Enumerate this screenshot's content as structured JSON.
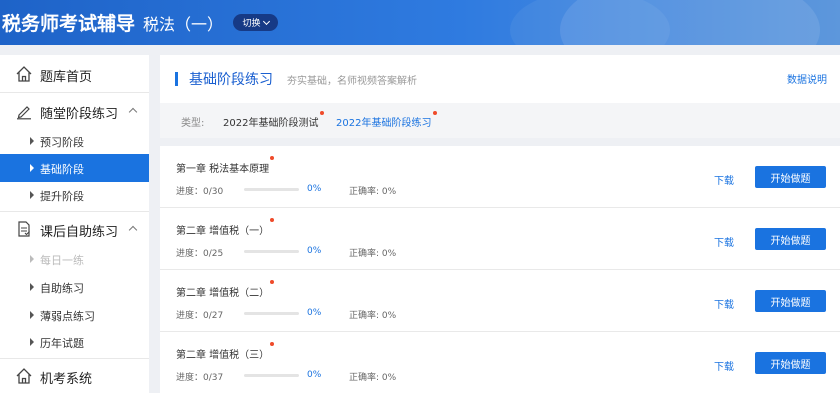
{
  "header": {
    "app_title": "税务师考试辅导",
    "subject": "税法（一）",
    "switch_label": "切换"
  },
  "sidebar": {
    "groups": [
      {
        "label": "题库首页",
        "icon": "home-icon"
      },
      {
        "label": "随堂阶段练习",
        "icon": "pen-icon"
      },
      {
        "label": "课后自助练习",
        "icon": "document-icon"
      },
      {
        "label": "机考系统",
        "icon": "home-icon"
      }
    ],
    "stage_items": [
      {
        "label": "预习阶段"
      },
      {
        "label": "基础阶段",
        "active": true
      },
      {
        "label": "提升阶段"
      }
    ],
    "self_items": [
      {
        "label": "每日一练",
        "disabled": true
      },
      {
        "label": "自助练习"
      },
      {
        "label": "薄弱点练习"
      },
      {
        "label": "历年试题"
      }
    ]
  },
  "panel": {
    "title": "基础阶段练习",
    "description": "夯实基础，名师视频答案解析",
    "explain_link": "数据说明"
  },
  "filter": {
    "label": "类型:",
    "options": [
      {
        "label": "2022年基础阶段测试",
        "active": false
      },
      {
        "label": "2022年基础阶段练习",
        "active": true
      }
    ]
  },
  "chapters": [
    {
      "name": "第一章 税法基本原理",
      "progress": "进度：0/30",
      "percent": "0%",
      "accuracy": "正确率: 0%",
      "progress_fraction": 0
    },
    {
      "name": "第二章 增值税（一）",
      "progress": "进度：0/25",
      "percent": "0%",
      "accuracy": "正确率: 0%",
      "progress_fraction": 0
    },
    {
      "name": "第二章 增值税（二）",
      "progress": "进度：0/27",
      "percent": "0%",
      "accuracy": "正确率: 0%",
      "progress_fraction": 0
    },
    {
      "name": "第二章 增值税（三）",
      "progress": "进度：0/37",
      "percent": "0%",
      "accuracy": "正确率: 0%",
      "progress_fraction": 0
    }
  ],
  "actions": {
    "download_label": "下载",
    "start_label": "开始做题"
  },
  "colors": {
    "accent": "#1a73e0",
    "header": "#1e63c8",
    "badge_dot": "#ef4b2a"
  }
}
